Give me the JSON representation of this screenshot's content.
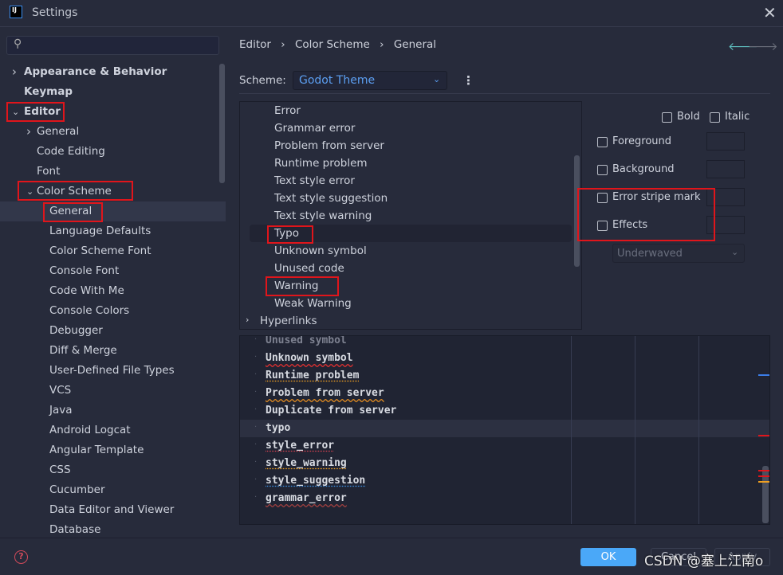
{
  "window": {
    "title": "Settings",
    "logo": "IJ"
  },
  "search": {
    "placeholder": "",
    "icon": "search-icon"
  },
  "sidebar": {
    "items": [
      {
        "label": "Appearance & Behavior",
        "level": 0,
        "chevron": "right",
        "bold": true
      },
      {
        "label": "Keymap",
        "level": 0,
        "bold": true
      },
      {
        "label": "Editor",
        "level": 0,
        "chevron": "down",
        "bold": true
      },
      {
        "label": "General",
        "level": 1,
        "chevron": "right"
      },
      {
        "label": "Code Editing",
        "level": 1
      },
      {
        "label": "Font",
        "level": 1
      },
      {
        "label": "Color Scheme",
        "level": 1,
        "chevron": "down"
      },
      {
        "label": "General",
        "level": 2,
        "selected": true
      },
      {
        "label": "Language Defaults",
        "level": 2
      },
      {
        "label": "Color Scheme Font",
        "level": 2
      },
      {
        "label": "Console Font",
        "level": 2
      },
      {
        "label": "Code With Me",
        "level": 2
      },
      {
        "label": "Console Colors",
        "level": 2
      },
      {
        "label": "Debugger",
        "level": 2
      },
      {
        "label": "Diff & Merge",
        "level": 2
      },
      {
        "label": "User-Defined File Types",
        "level": 2
      },
      {
        "label": "VCS",
        "level": 2
      },
      {
        "label": "Java",
        "level": 2
      },
      {
        "label": "Android Logcat",
        "level": 2
      },
      {
        "label": "Angular Template",
        "level": 2
      },
      {
        "label": "CSS",
        "level": 2
      },
      {
        "label": "Cucumber",
        "level": 2
      },
      {
        "label": "Data Editor and Viewer",
        "level": 2
      },
      {
        "label": "Database",
        "level": 2
      }
    ]
  },
  "breadcrumb": [
    "Editor",
    "Color Scheme",
    "General"
  ],
  "scheme": {
    "label": "Scheme:",
    "value": "Godot Theme"
  },
  "attributes": {
    "items": [
      "Error",
      "Grammar error",
      "Problem from server",
      "Runtime problem",
      "Text style error",
      "Text style suggestion",
      "Text style warning",
      "Typo",
      "Unknown symbol",
      "Unused code",
      "Warning",
      "Weak Warning"
    ],
    "selected": "Typo",
    "group": "Hyperlinks"
  },
  "options": {
    "bold": "Bold",
    "italic": "Italic",
    "foreground": "Foreground",
    "background": "Background",
    "error_stripe": "Error stripe mark",
    "effects": "Effects",
    "effect_type": "Underwaved"
  },
  "preview": {
    "lines": [
      {
        "text": "Unused symbol",
        "style": "unused"
      },
      {
        "text": "Unknown symbol",
        "underline": "wavy",
        "color": "#e03030"
      },
      {
        "text": "Runtime problem",
        "underline": "dotted",
        "color": "#f0a020"
      },
      {
        "text": "Problem from server",
        "underline": "wavy",
        "color": "#e08a20"
      },
      {
        "text": "Duplicate from server"
      },
      {
        "text": "typo",
        "highlight": true
      },
      {
        "text": "style_error",
        "underline": "dotted",
        "color": "#d04050"
      },
      {
        "text": "style_warning",
        "underline": "dotted",
        "color": "#f0a020"
      },
      {
        "text": "style_suggestion",
        "underline": "dotted",
        "color": "#3a8ee0"
      },
      {
        "text": "grammar_error",
        "underline": "wavy",
        "color": "#a04040"
      }
    ]
  },
  "buttons": {
    "ok": "OK",
    "cancel": "Cancel",
    "apply": "Apply"
  },
  "watermark": "CSDN @塞上江南o",
  "colors": {
    "accent": "#4aa8f8",
    "scheme_value": "#5c9ff2",
    "highlight_box": "#e0151b"
  }
}
